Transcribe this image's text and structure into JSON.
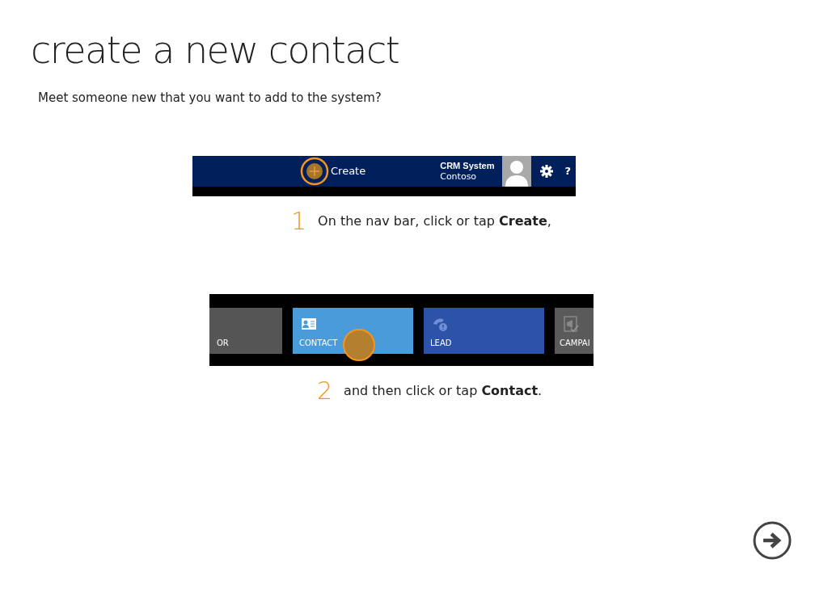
{
  "title": "create a new contact",
  "subtitle": "Meet someone new that you want to add to the system?",
  "steps": [
    {
      "number": "1",
      "text": "On the nav bar, click or tap **Create**,",
      "shot": {
        "kind": "navbar",
        "create_label": "Create",
        "org_name": "CRM System",
        "org_sub": "Contoso",
        "help": "?",
        "tapped": true
      }
    },
    {
      "number": "2",
      "text": "and then click or tap **Contact**.",
      "shot": {
        "kind": "tiles",
        "tiles": [
          {
            "label": "OR",
            "kind": "plain",
            "color": "#555555",
            "tapped": false
          },
          {
            "label": "CONTACT",
            "kind": "contact",
            "color": "#4a9bd9",
            "tapped": true
          },
          {
            "label": "LEAD",
            "kind": "lead",
            "color": "#2d53a8",
            "tapped": false
          },
          {
            "label": "CAMPAI",
            "kind": "campaign",
            "color": "#5a5a5a",
            "tapped": false
          }
        ]
      }
    }
  ]
}
